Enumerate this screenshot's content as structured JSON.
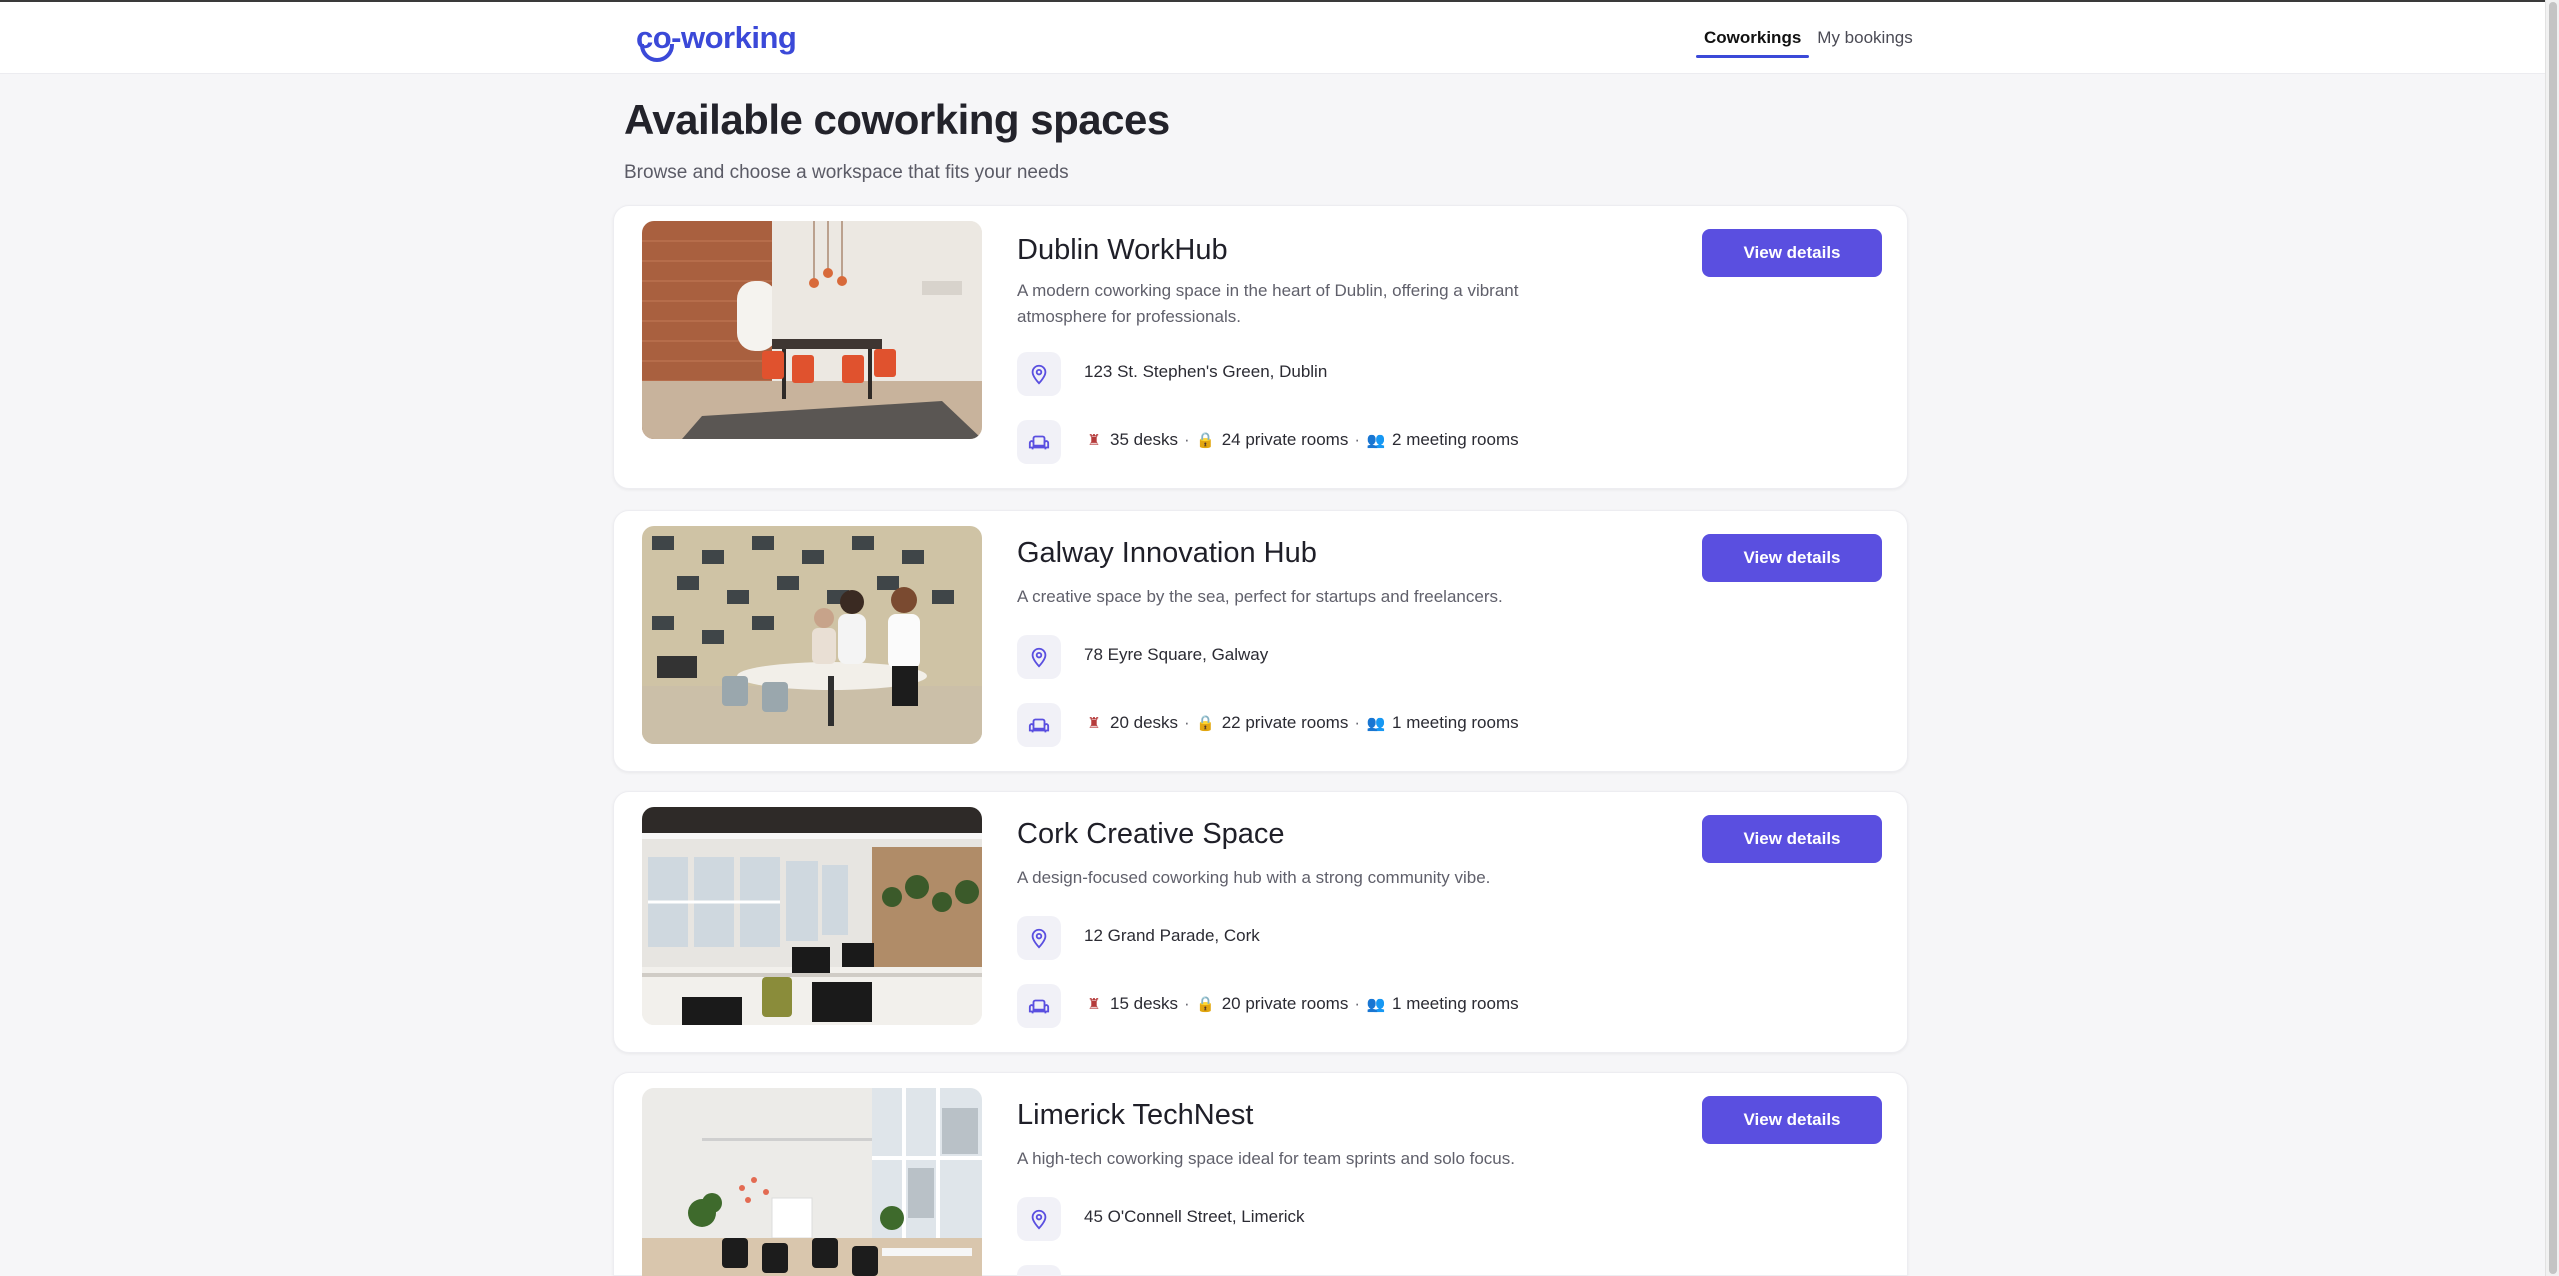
{
  "app": {
    "logo_text": "co-working"
  },
  "nav": {
    "tabs": [
      {
        "label": "Coworkings",
        "active": true
      },
      {
        "label": "My bookings",
        "active": false
      }
    ]
  },
  "page": {
    "title": "Available coworking spaces",
    "subtitle": "Browse and choose a workspace that fits your needs"
  },
  "cards": [
    {
      "name": "Dublin WorkHub",
      "description": "A modern coworking space in the heart of Dublin, offering a vibrant atmosphere for professionals.",
      "address": "123 St. Stephen's Green, Dublin",
      "desks": "35 desks",
      "private_rooms": "24 private rooms",
      "meeting_rooms": "2 meeting rooms",
      "button": "View details"
    },
    {
      "name": "Galway Innovation Hub",
      "description": "A creative space by the sea, perfect for startups and freelancers.",
      "address": "78 Eyre Square, Galway",
      "desks": "20 desks",
      "private_rooms": "22 private rooms",
      "meeting_rooms": "1 meeting rooms",
      "button": "View details"
    },
    {
      "name": "Cork Creative Space",
      "description": "A design-focused coworking hub with a strong community vibe.",
      "address": "12 Grand Parade, Cork",
      "desks": "15 desks",
      "private_rooms": "20 private rooms",
      "meeting_rooms": "1 meeting rooms",
      "button": "View details"
    },
    {
      "name": "Limerick TechNest",
      "description": "A high-tech coworking space ideal for team sprints and solo focus.",
      "address": "45 O'Connell Street, Limerick",
      "button": "View details"
    }
  ],
  "colors": {
    "accent": "#5a4fe0",
    "brand": "#3b49d8",
    "background": "#f6f6f8"
  },
  "icons": {
    "address": "location-pin-icon",
    "capacity": "armchair-icon",
    "desks": "chair-icon",
    "private_rooms": "lock-icon",
    "meeting_rooms": "people-icon"
  },
  "separator": "·"
}
